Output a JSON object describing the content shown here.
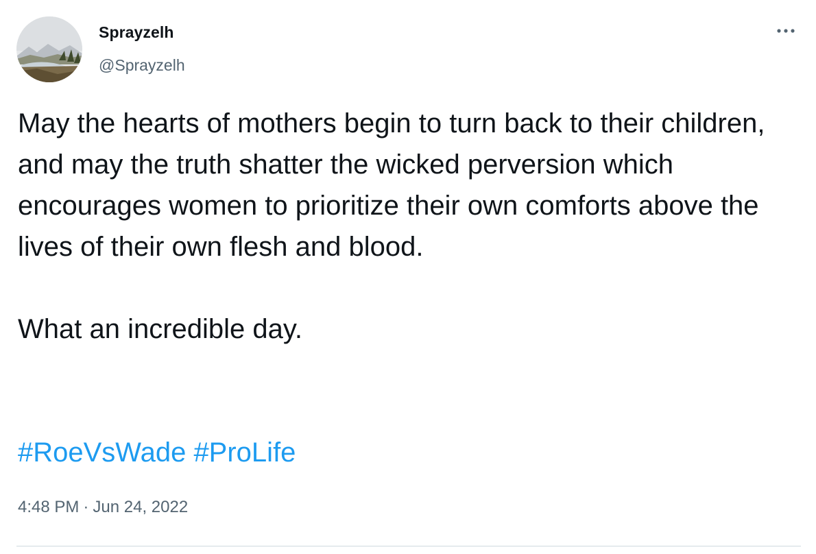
{
  "author": {
    "display_name": "Sprayzelh",
    "handle": "@Sprayzelh",
    "avatar_icon": "landscape-avatar-image"
  },
  "more_icon": "more-horizontal-icon",
  "tweet": {
    "paragraph_1": "May the hearts of mothers begin to turn back to their children, and may the truth shatter the wicked perversion which encourages women to prioritize their own comforts above the lives of their own flesh and blood.",
    "paragraph_2": "What an incredible day.",
    "hashtags": [
      "#RoeVsWade",
      "#ProLife"
    ]
  },
  "meta": {
    "time": "4:48 PM",
    "separator": "·",
    "date": "Jun 24, 2022"
  },
  "colors": {
    "text": "#0f1419",
    "secondary": "#536471",
    "link": "#1d9bf0",
    "divider": "#cfd9de"
  }
}
